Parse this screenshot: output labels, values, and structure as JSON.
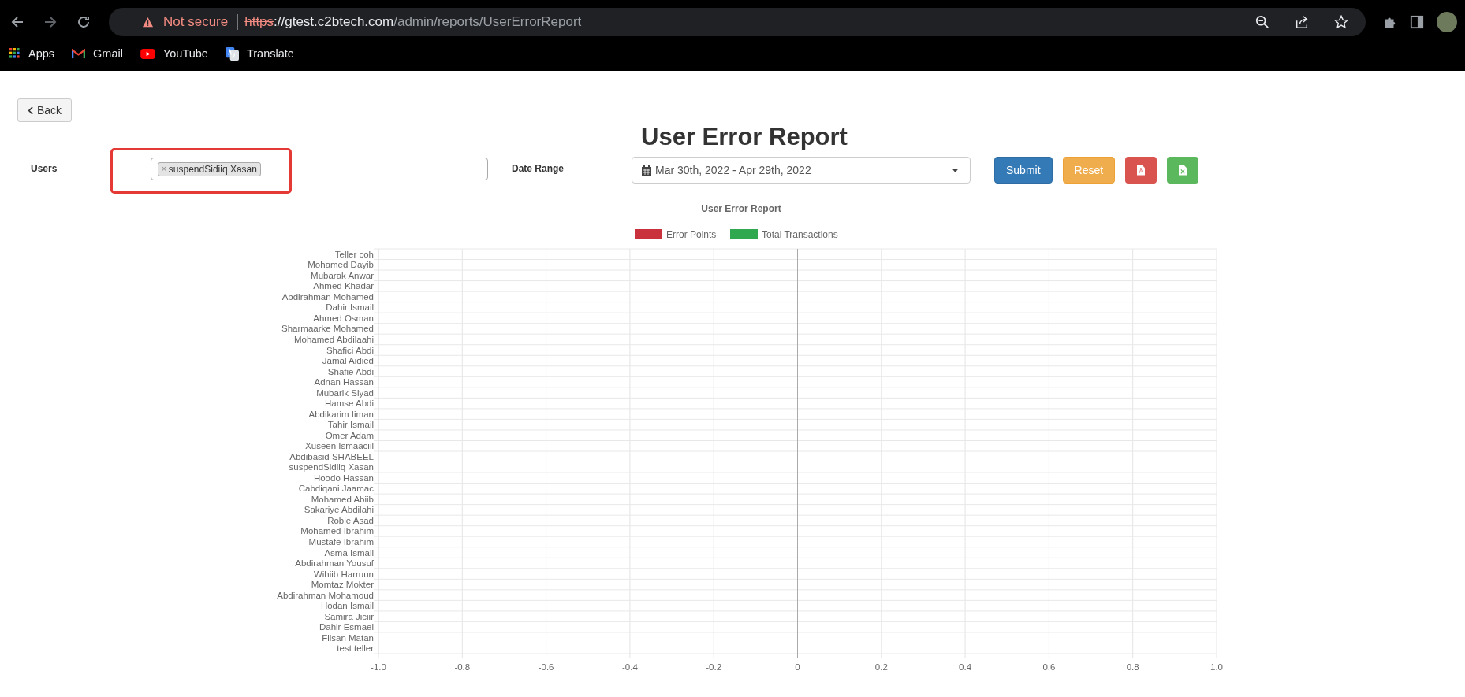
{
  "browser": {
    "security_label": "Not secure",
    "url_scheme": "https",
    "url_host": "://gtest.c2btech.com",
    "url_path": "/admin/reports/UserErrorReport",
    "bookmarks": [
      {
        "label": "Apps",
        "kind": "apps"
      },
      {
        "label": "Gmail",
        "kind": "gmail"
      },
      {
        "label": "YouTube",
        "kind": "youtube"
      },
      {
        "label": "Translate",
        "kind": "translate"
      }
    ]
  },
  "back_button": "Back",
  "title": "User Error Report",
  "filters": {
    "users_label": "Users",
    "users_tags": [
      "suspendSidiiq Xasan"
    ],
    "tag_remove": "×",
    "date_label": "Date Range",
    "date_value": "Mar 30th, 2022 - Apr 29th, 2022"
  },
  "buttons": [
    {
      "label": "Submit",
      "kind": "submit"
    },
    {
      "label": "Reset",
      "kind": "reset"
    },
    {
      "kind": "pdf"
    },
    {
      "kind": "excel"
    }
  ],
  "chart": {
    "chart_data": {
      "type": "bar",
      "orientation": "horizontal",
      "grid": true,
      "title": "User Error Report",
      "categories": [
        "Teller coh",
        "Mohamed Dayib",
        "Mubarak Anwar",
        "Ahmed Khadar",
        "Abdirahman Mohamed",
        "Dahir Ismail",
        "Ahmed Osman",
        "Sharmaarke Mohamed",
        "Mohamed Abdilaahi",
        "Shafici Abdi",
        "Jamal Aidied",
        "Shafie Abdi",
        "Adnan Hassan",
        "Mubarik Siyad",
        "Hamse Abdi",
        "Abdikarim Iiman",
        "Tahir Ismail",
        "Omer Adam",
        "Xuseen Ismaaciil",
        "Abdibasid SHABEEL",
        "suspendSidiiq Xasan",
        "Hoodo Hassan",
        "Cabdiqani Jaamac",
        "Mohamed Abiib",
        "Sakariye Abdilahi",
        "Roble Asad",
        "Mohamed Ibrahim",
        "Mustafe Ibrahim",
        "Asma Ismail",
        "Abdirahman Yousuf",
        "Wihiib Harruun",
        "Momtaz Mokter",
        "Abdirahman Mohamoud",
        "Hodan Ismail",
        "Samira Jiciir",
        "Dahir Esmael",
        "Filsan Matan",
        "test teller"
      ],
      "series": [
        {
          "name": "Error Points",
          "color": "#c9323c",
          "values": [
            0,
            0,
            0,
            0,
            0,
            0,
            0,
            0,
            0,
            0,
            0,
            0,
            0,
            0,
            0,
            0,
            0,
            0,
            0,
            0,
            0,
            0,
            0,
            0,
            0,
            0,
            0,
            0,
            0,
            0,
            0,
            0,
            0,
            0,
            0,
            0,
            0,
            0
          ]
        },
        {
          "name": "Total Transactions",
          "color": "#2fa84f",
          "values": [
            0,
            0,
            0,
            0,
            0,
            0,
            0,
            0,
            0,
            0,
            0,
            0,
            0,
            0,
            0,
            0,
            0,
            0,
            0,
            0,
            0,
            0,
            0,
            0,
            0,
            0,
            0,
            0,
            0,
            0,
            0,
            0,
            0,
            0,
            0,
            0,
            0,
            0
          ]
        }
      ],
      "xlim": [
        -1,
        1
      ],
      "xticks": [
        {
          "value": -1,
          "label": "-1.0"
        },
        {
          "value": -0.8,
          "label": "-0.8"
        },
        {
          "value": -0.6,
          "label": "-0.6"
        },
        {
          "value": -0.4,
          "label": "-0.4"
        },
        {
          "value": -0.2,
          "label": "-0.2"
        },
        {
          "value": 0,
          "label": "0"
        },
        {
          "value": 0.2,
          "label": "0.2"
        },
        {
          "value": 0.4,
          "label": "0.4"
        },
        {
          "value": 0.6,
          "label": "0.6"
        },
        {
          "value": 0.8,
          "label": "0.8"
        },
        {
          "value": 1,
          "label": "1.0"
        }
      ]
    }
  }
}
